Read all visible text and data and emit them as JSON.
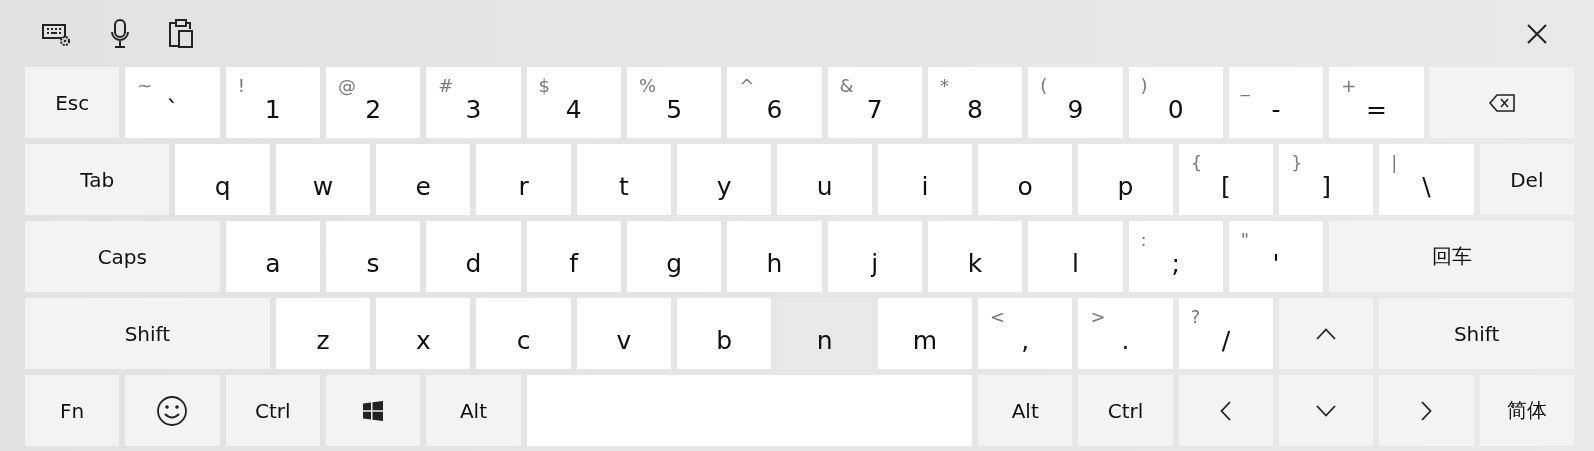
{
  "rows": [
    {
      "keys": [
        {
          "kind": "function",
          "label": "Esc",
          "highlighted": false
        },
        {
          "kind": "char",
          "label": "`",
          "shift": "~",
          "highlighted": false
        },
        {
          "kind": "char",
          "label": "1",
          "shift": "!",
          "highlighted": false
        },
        {
          "kind": "char",
          "label": "2",
          "shift": "@",
          "highlighted": false
        },
        {
          "kind": "char",
          "label": "3",
          "shift": "#",
          "highlighted": false
        },
        {
          "kind": "char",
          "label": "4",
          "shift": "$",
          "highlighted": false
        },
        {
          "kind": "char",
          "label": "5",
          "shift": "%",
          "highlighted": false
        },
        {
          "kind": "char",
          "label": "6",
          "shift": "^",
          "highlighted": false
        },
        {
          "kind": "char",
          "label": "7",
          "shift": "&",
          "highlighted": false
        },
        {
          "kind": "char",
          "label": "8",
          "shift": "*",
          "highlighted": false
        },
        {
          "kind": "char",
          "label": "9",
          "shift": "(",
          "highlighted": false
        },
        {
          "kind": "char",
          "label": "0",
          "shift": ")",
          "highlighted": false
        },
        {
          "kind": "char",
          "label": "-",
          "shift": "_",
          "highlighted": false
        },
        {
          "kind": "char",
          "label": "=",
          "shift": "+",
          "highlighted": false
        },
        {
          "kind": "backspace",
          "highlighted": false
        }
      ]
    },
    {
      "keys": [
        {
          "kind": "function",
          "label": "Tab",
          "highlighted": false
        },
        {
          "kind": "char",
          "label": "q",
          "highlighted": false
        },
        {
          "kind": "char",
          "label": "w",
          "highlighted": false
        },
        {
          "kind": "char",
          "label": "e",
          "highlighted": false
        },
        {
          "kind": "char",
          "label": "r",
          "highlighted": false
        },
        {
          "kind": "char",
          "label": "t",
          "highlighted": false
        },
        {
          "kind": "char",
          "label": "y",
          "highlighted": false
        },
        {
          "kind": "char",
          "label": "u",
          "highlighted": false
        },
        {
          "kind": "char",
          "label": "i",
          "highlighted": false
        },
        {
          "kind": "char",
          "label": "o",
          "highlighted": false
        },
        {
          "kind": "char",
          "label": "p",
          "highlighted": false
        },
        {
          "kind": "char",
          "label": "[",
          "shift": "{",
          "highlighted": false
        },
        {
          "kind": "char",
          "label": "]",
          "shift": "}",
          "highlighted": false
        },
        {
          "kind": "char",
          "label": "\\",
          "shift": "|",
          "highlighted": false
        },
        {
          "kind": "function",
          "label": "Del",
          "highlighted": false
        }
      ]
    },
    {
      "keys": [
        {
          "kind": "function",
          "label": "Caps",
          "highlighted": false
        },
        {
          "kind": "char",
          "label": "a",
          "highlighted": false
        },
        {
          "kind": "char",
          "label": "s",
          "highlighted": false
        },
        {
          "kind": "char",
          "label": "d",
          "highlighted": false
        },
        {
          "kind": "char",
          "label": "f",
          "highlighted": false
        },
        {
          "kind": "char",
          "label": "g",
          "highlighted": false
        },
        {
          "kind": "char",
          "label": "h",
          "highlighted": false
        },
        {
          "kind": "char",
          "label": "j",
          "highlighted": false
        },
        {
          "kind": "char",
          "label": "k",
          "highlighted": false
        },
        {
          "kind": "char",
          "label": "l",
          "highlighted": false
        },
        {
          "kind": "char",
          "label": ";",
          "shift": ":",
          "highlighted": false
        },
        {
          "kind": "char",
          "label": "'",
          "shift": "\"",
          "highlighted": false
        },
        {
          "kind": "function",
          "label": "回车",
          "highlighted": false
        }
      ]
    },
    {
      "keys": [
        {
          "kind": "function",
          "label": "Shift",
          "highlighted": false
        },
        {
          "kind": "char",
          "label": "z",
          "highlighted": false
        },
        {
          "kind": "char",
          "label": "x",
          "highlighted": false
        },
        {
          "kind": "char",
          "label": "c",
          "highlighted": false
        },
        {
          "kind": "char",
          "label": "v",
          "highlighted": false
        },
        {
          "kind": "char",
          "label": "b",
          "highlighted": false
        },
        {
          "kind": "char",
          "label": "n",
          "highlighted": true
        },
        {
          "kind": "char",
          "label": "m",
          "highlighted": false
        },
        {
          "kind": "char",
          "label": ",",
          "shift": "<",
          "highlighted": false
        },
        {
          "kind": "char",
          "label": ".",
          "shift": ">",
          "highlighted": false
        },
        {
          "kind": "char",
          "label": "/",
          "shift": "?",
          "highlighted": false
        },
        {
          "kind": "up",
          "highlighted": false
        },
        {
          "kind": "function",
          "label": "Shift",
          "highlighted": false
        }
      ]
    },
    {
      "keys": [
        {
          "kind": "function",
          "label": "Fn",
          "highlighted": false
        },
        {
          "kind": "emoji",
          "highlighted": false
        },
        {
          "kind": "function",
          "label": "Ctrl",
          "highlighted": false
        },
        {
          "kind": "windows",
          "highlighted": false
        },
        {
          "kind": "function",
          "label": "Alt",
          "highlighted": false
        },
        {
          "kind": "space",
          "highlighted": false
        },
        {
          "kind": "function",
          "label": "Alt",
          "highlighted": false
        },
        {
          "kind": "function",
          "label": "Ctrl",
          "highlighted": false
        },
        {
          "kind": "left",
          "highlighted": false
        },
        {
          "kind": "down",
          "highlighted": false
        },
        {
          "kind": "right",
          "highlighted": false
        },
        {
          "kind": "function",
          "label": "简体",
          "highlighted": false
        }
      ]
    }
  ]
}
